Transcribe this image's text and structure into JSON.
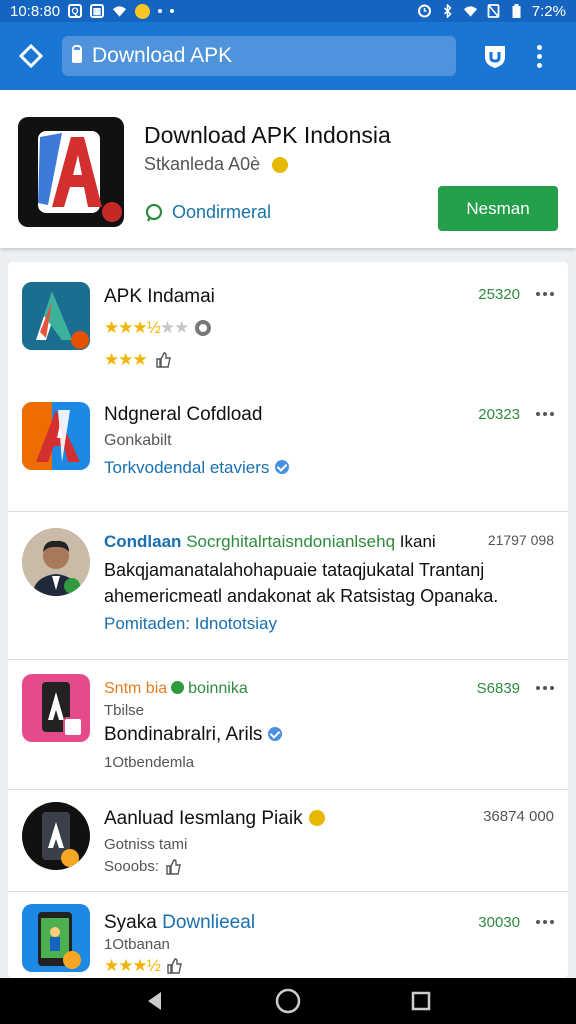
{
  "status_bar": {
    "time_left": "10:8:80",
    "time_right": "7:2%"
  },
  "browser": {
    "url_text": "Download APK"
  },
  "header": {
    "title": "Download APK Indonsia",
    "subtitle": "Stkanleda A0è",
    "developer": "Oondirmeral",
    "action_label": "Nesman"
  },
  "list": {
    "items": [
      {
        "name": "APK Indamai",
        "number": "25320",
        "rating_stars": 3.5
      },
      {
        "name": "Ndgneral Cofdload",
        "sub": "Gonkabilt",
        "tag": "Torkvodendal etaviers",
        "number": "20323"
      },
      {
        "name_blue": "Condlaan",
        "name_green": "Socrghitalrtaisndonianlsehq",
        "name_tail": " Ikani",
        "number": "21797 098",
        "line2": "Bakqjamanatalahohapuaie tataqjukatal Trantanj",
        "line3": "ahemericmeatl andakonat ak Ratsistag Opanaka.",
        "tag": "Pomitaden: Idnototsiay"
      },
      {
        "name_orange": "Sntm bia",
        "name_green": "boinnika",
        "sub": "Tbilse",
        "line2": "Bondinabralri, Arils",
        "line3": "1Otbendemla",
        "number": "S6839"
      },
      {
        "name": "Aanluad Iesmlang Piaik",
        "sub": "Gotniss tami",
        "line3": "Sooobs:",
        "number": "36874 000"
      },
      {
        "name_black": "Syaka",
        "name_blue": "Downlieeal",
        "sub": "1Otbanan",
        "number": "30030",
        "rating_stars": 3.5
      }
    ]
  },
  "colors": {
    "primary": "#1976d2",
    "status": "#1565c0",
    "accent_green": "#25a04a",
    "link_blue": "#1a6fb0",
    "number_green": "#2e8b3e"
  }
}
